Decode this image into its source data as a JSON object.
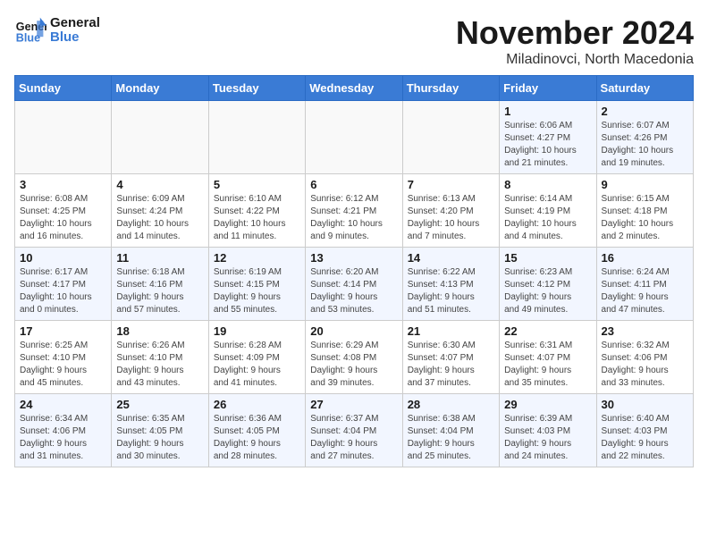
{
  "header": {
    "logo_line1": "General",
    "logo_line2": "Blue",
    "month": "November 2024",
    "location": "Miladinovci, North Macedonia"
  },
  "weekdays": [
    "Sunday",
    "Monday",
    "Tuesday",
    "Wednesday",
    "Thursday",
    "Friday",
    "Saturday"
  ],
  "weeks": [
    [
      {
        "day": "",
        "info": ""
      },
      {
        "day": "",
        "info": ""
      },
      {
        "day": "",
        "info": ""
      },
      {
        "day": "",
        "info": ""
      },
      {
        "day": "",
        "info": ""
      },
      {
        "day": "1",
        "info": "Sunrise: 6:06 AM\nSunset: 4:27 PM\nDaylight: 10 hours\nand 21 minutes."
      },
      {
        "day": "2",
        "info": "Sunrise: 6:07 AM\nSunset: 4:26 PM\nDaylight: 10 hours\nand 19 minutes."
      }
    ],
    [
      {
        "day": "3",
        "info": "Sunrise: 6:08 AM\nSunset: 4:25 PM\nDaylight: 10 hours\nand 16 minutes."
      },
      {
        "day": "4",
        "info": "Sunrise: 6:09 AM\nSunset: 4:24 PM\nDaylight: 10 hours\nand 14 minutes."
      },
      {
        "day": "5",
        "info": "Sunrise: 6:10 AM\nSunset: 4:22 PM\nDaylight: 10 hours\nand 11 minutes."
      },
      {
        "day": "6",
        "info": "Sunrise: 6:12 AM\nSunset: 4:21 PM\nDaylight: 10 hours\nand 9 minutes."
      },
      {
        "day": "7",
        "info": "Sunrise: 6:13 AM\nSunset: 4:20 PM\nDaylight: 10 hours\nand 7 minutes."
      },
      {
        "day": "8",
        "info": "Sunrise: 6:14 AM\nSunset: 4:19 PM\nDaylight: 10 hours\nand 4 minutes."
      },
      {
        "day": "9",
        "info": "Sunrise: 6:15 AM\nSunset: 4:18 PM\nDaylight: 10 hours\nand 2 minutes."
      }
    ],
    [
      {
        "day": "10",
        "info": "Sunrise: 6:17 AM\nSunset: 4:17 PM\nDaylight: 10 hours\nand 0 minutes."
      },
      {
        "day": "11",
        "info": "Sunrise: 6:18 AM\nSunset: 4:16 PM\nDaylight: 9 hours\nand 57 minutes."
      },
      {
        "day": "12",
        "info": "Sunrise: 6:19 AM\nSunset: 4:15 PM\nDaylight: 9 hours\nand 55 minutes."
      },
      {
        "day": "13",
        "info": "Sunrise: 6:20 AM\nSunset: 4:14 PM\nDaylight: 9 hours\nand 53 minutes."
      },
      {
        "day": "14",
        "info": "Sunrise: 6:22 AM\nSunset: 4:13 PM\nDaylight: 9 hours\nand 51 minutes."
      },
      {
        "day": "15",
        "info": "Sunrise: 6:23 AM\nSunset: 4:12 PM\nDaylight: 9 hours\nand 49 minutes."
      },
      {
        "day": "16",
        "info": "Sunrise: 6:24 AM\nSunset: 4:11 PM\nDaylight: 9 hours\nand 47 minutes."
      }
    ],
    [
      {
        "day": "17",
        "info": "Sunrise: 6:25 AM\nSunset: 4:10 PM\nDaylight: 9 hours\nand 45 minutes."
      },
      {
        "day": "18",
        "info": "Sunrise: 6:26 AM\nSunset: 4:10 PM\nDaylight: 9 hours\nand 43 minutes."
      },
      {
        "day": "19",
        "info": "Sunrise: 6:28 AM\nSunset: 4:09 PM\nDaylight: 9 hours\nand 41 minutes."
      },
      {
        "day": "20",
        "info": "Sunrise: 6:29 AM\nSunset: 4:08 PM\nDaylight: 9 hours\nand 39 minutes."
      },
      {
        "day": "21",
        "info": "Sunrise: 6:30 AM\nSunset: 4:07 PM\nDaylight: 9 hours\nand 37 minutes."
      },
      {
        "day": "22",
        "info": "Sunrise: 6:31 AM\nSunset: 4:07 PM\nDaylight: 9 hours\nand 35 minutes."
      },
      {
        "day": "23",
        "info": "Sunrise: 6:32 AM\nSunset: 4:06 PM\nDaylight: 9 hours\nand 33 minutes."
      }
    ],
    [
      {
        "day": "24",
        "info": "Sunrise: 6:34 AM\nSunset: 4:06 PM\nDaylight: 9 hours\nand 31 minutes."
      },
      {
        "day": "25",
        "info": "Sunrise: 6:35 AM\nSunset: 4:05 PM\nDaylight: 9 hours\nand 30 minutes."
      },
      {
        "day": "26",
        "info": "Sunrise: 6:36 AM\nSunset: 4:05 PM\nDaylight: 9 hours\nand 28 minutes."
      },
      {
        "day": "27",
        "info": "Sunrise: 6:37 AM\nSunset: 4:04 PM\nDaylight: 9 hours\nand 27 minutes."
      },
      {
        "day": "28",
        "info": "Sunrise: 6:38 AM\nSunset: 4:04 PM\nDaylight: 9 hours\nand 25 minutes."
      },
      {
        "day": "29",
        "info": "Sunrise: 6:39 AM\nSunset: 4:03 PM\nDaylight: 9 hours\nand 24 minutes."
      },
      {
        "day": "30",
        "info": "Sunrise: 6:40 AM\nSunset: 4:03 PM\nDaylight: 9 hours\nand 22 minutes."
      }
    ]
  ]
}
